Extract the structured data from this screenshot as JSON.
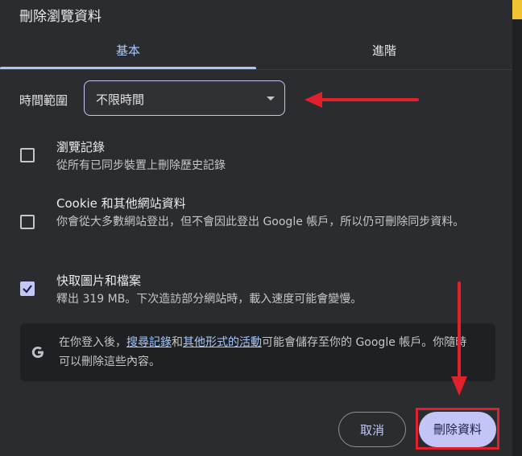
{
  "dialog": {
    "title": "刪除瀏覽資料",
    "tabs": [
      {
        "label": "基本",
        "active": true
      },
      {
        "label": "進階",
        "active": false
      }
    ],
    "time_range": {
      "label": "時間範圍",
      "value": "不限時間"
    },
    "items": [
      {
        "title": "瀏覽記錄",
        "description": "從所有已同步裝置上刪除歷史記錄",
        "checked": false
      },
      {
        "title": "Cookie 和其他網站資料",
        "description": "你會從大多數網站登出，但不會因此登出 Google 帳戶，所以仍可刪除同步資料。",
        "checked": false
      },
      {
        "title": "快取圖片和檔案",
        "description": "釋出 319 MB。下次造訪部分網站時，載入速度可能會變慢。",
        "checked": true
      }
    ],
    "info": {
      "pre": "在你登入後，",
      "link1": "搜尋記錄",
      "mid": "和",
      "link2": "其他形式的活動",
      "post": "可能會儲存至你的 Google 帳戶。你隨時可以刪除這些內容。"
    },
    "buttons": {
      "cancel": "取消",
      "delete": "刪除資料"
    }
  },
  "colors": {
    "accent": "#a8c7fa",
    "primary_button": "#c2c5f6",
    "annotation": "#e0202a"
  }
}
